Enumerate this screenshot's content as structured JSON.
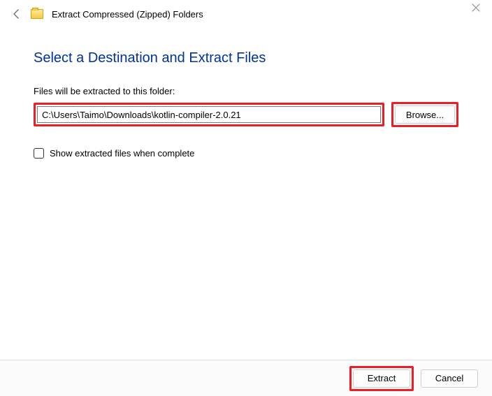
{
  "window": {
    "title": "Extract Compressed (Zipped) Folders"
  },
  "heading": "Select a Destination and Extract Files",
  "path": {
    "label": "Files will be extracted to this folder:",
    "value": "C:\\Users\\Taimo\\Downloads\\kotlin-compiler-2.0.21",
    "browse_label": "Browse..."
  },
  "checkbox": {
    "label": "Show extracted files when complete",
    "checked": false
  },
  "footer": {
    "extract_label": "Extract",
    "cancel_label": "Cancel"
  }
}
